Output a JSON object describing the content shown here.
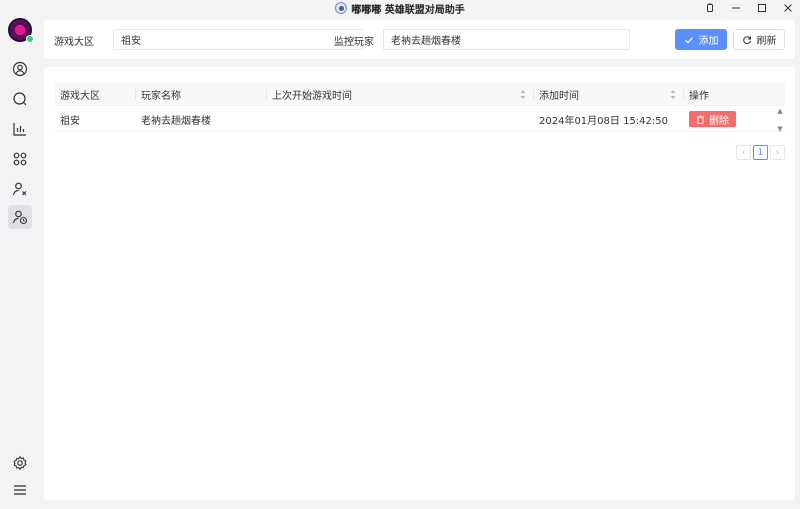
{
  "titlebar": {
    "title": "嘟嘟嘟 英雄联盟对局助手",
    "controls": [
      "pin-icon",
      "minimize-icon",
      "maximize-icon",
      "close-icon"
    ]
  },
  "sidebar": {
    "items": [
      {
        "name": "profile",
        "icon": "user-circle-icon"
      },
      {
        "name": "search",
        "icon": "search-icon"
      },
      {
        "name": "stats",
        "icon": "chart-icon"
      },
      {
        "name": "apps",
        "icon": "grid-icon"
      },
      {
        "name": "blacklist",
        "icon": "user-x-icon"
      },
      {
        "name": "watch",
        "icon": "user-clock-icon",
        "active": true
      }
    ],
    "bottom": [
      {
        "name": "settings",
        "icon": "gear-icon"
      },
      {
        "name": "menu",
        "icon": "menu-icon"
      }
    ]
  },
  "filter": {
    "region_label": "游戏大区",
    "region_value": "祖安",
    "player_label": "监控玩家",
    "player_value": "老衲去趟烟春楼",
    "add_label": "添加",
    "refresh_label": "刷新"
  },
  "table": {
    "columns": [
      "游戏大区",
      "玩家名称",
      "上次开始游戏时间",
      "添加时间",
      "操作"
    ],
    "rows": [
      {
        "region": "祖安",
        "player": "老衲去趟烟春楼",
        "last_game": "",
        "added": "2024年01月08日 15:42:50",
        "action": "删除"
      }
    ]
  },
  "pagination": {
    "prev": "‹",
    "current": "1",
    "next": "›"
  },
  "colors": {
    "primary": "#5b8ff9",
    "danger": "#f56c6c",
    "online": "#37c97a"
  }
}
